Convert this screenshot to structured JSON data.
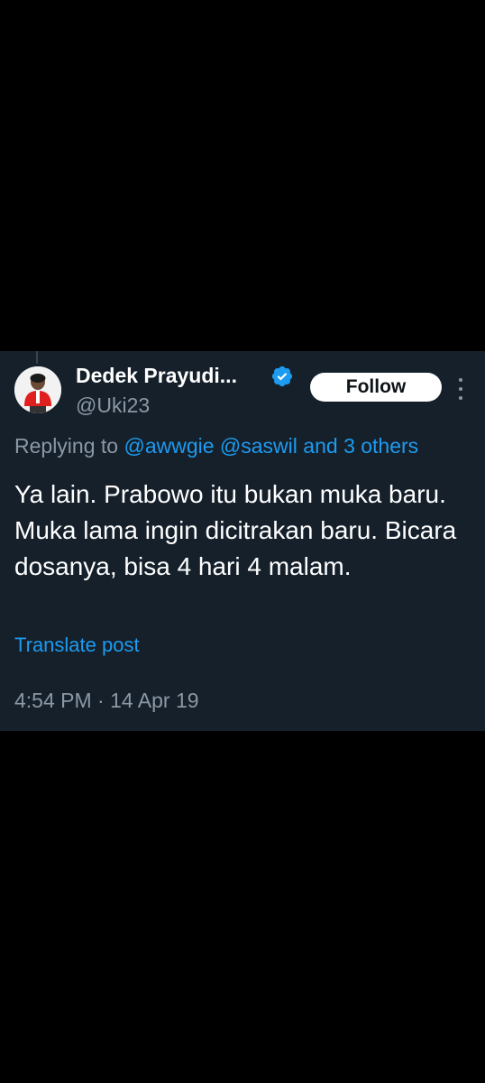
{
  "tweet": {
    "author": {
      "display_name": "Dedek Prayudi...",
      "handle": "@Uki23",
      "avatar_icon": "user-avatar",
      "verified_icon": "verified-badge-icon",
      "verified_color": "#1d9bf0"
    },
    "follow_label": "Follow",
    "more_icon": "more-vertical-icon",
    "replying": {
      "prefix": "Replying to",
      "mention_1": "@awwgie",
      "mention_2": "@saswil",
      "and": "and",
      "others": "3 others"
    },
    "text": "Ya lain. Prabowo itu bukan muka baru. Muka lama ingin dicitrakan baru. Bicara dosanya, bisa 4 hari 4 malam.",
    "translate_label": "Translate post",
    "timestamp": "4:54 PM · 14 Apr 19"
  },
  "colors": {
    "page_background": "#000000",
    "card_background": "#15202b",
    "text_primary": "#ffffff",
    "text_secondary": "#8b98a5",
    "accent": "#1d9bf0",
    "follow_button_background": "#ffffff"
  }
}
